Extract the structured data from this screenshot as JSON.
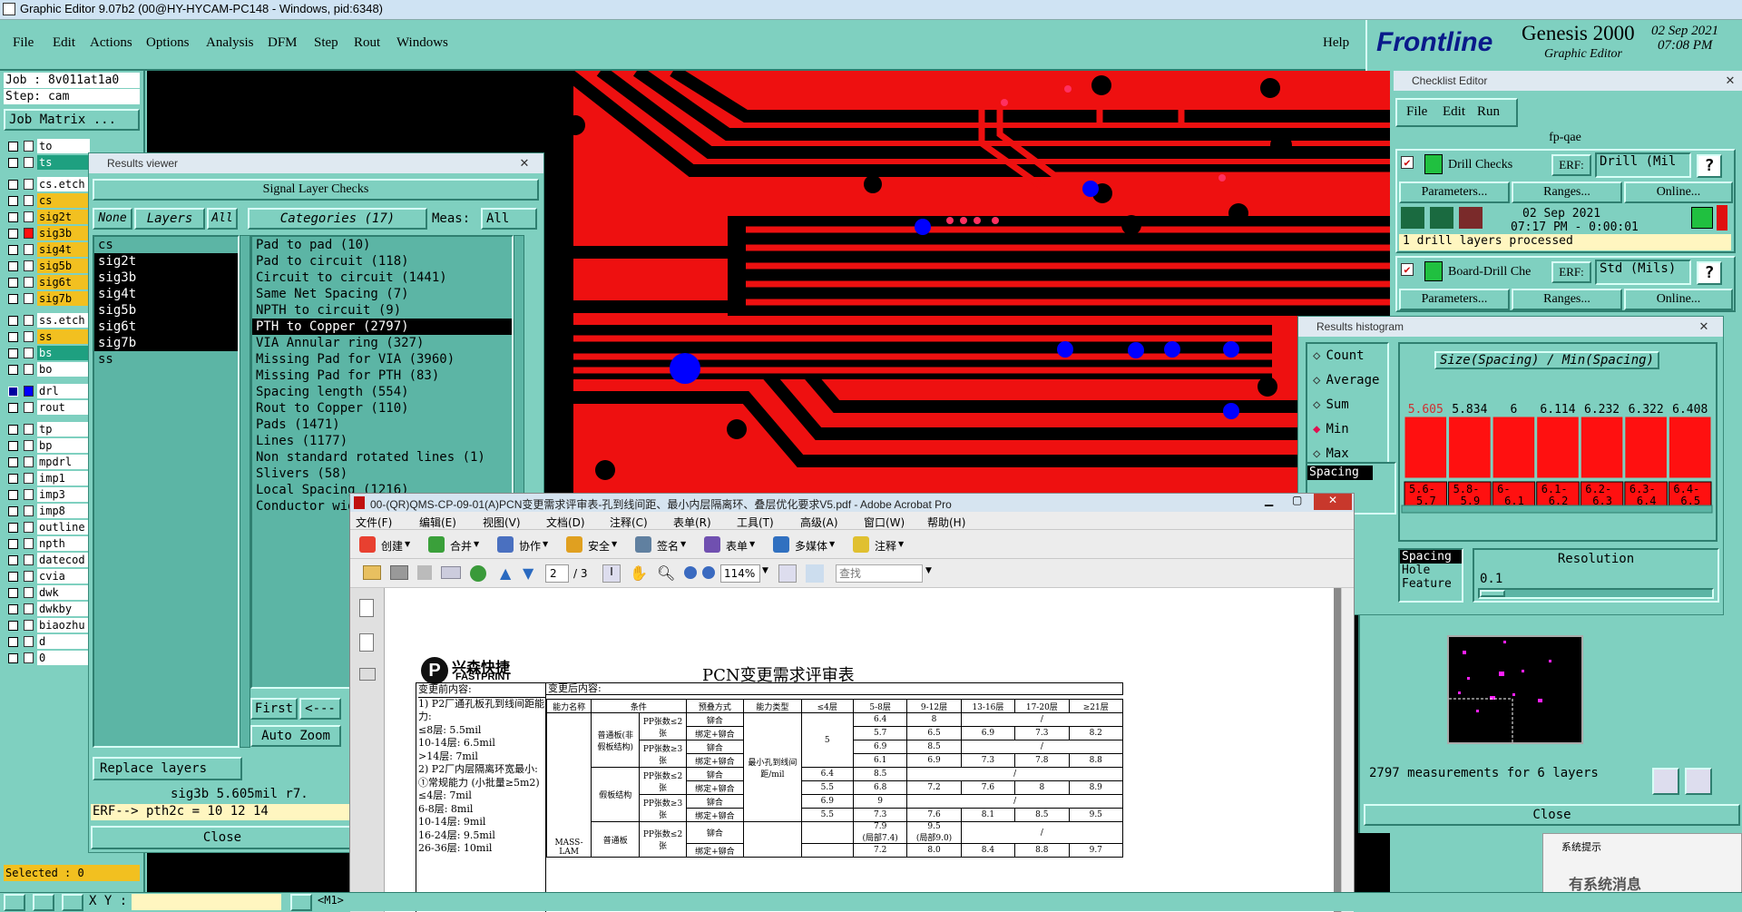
{
  "titlebar": {
    "title": "Graphic Editor 9.07b2 (00@HY-HYCAM-PC148 - Windows, pid:6348)"
  },
  "menu": {
    "items": [
      "File",
      "Edit",
      "Actions",
      "Options",
      "Analysis",
      "DFM",
      "Step",
      "Rout",
      "Windows"
    ],
    "help": "Help"
  },
  "brand": {
    "logo": "Frontline",
    "product": "Genesis 2000",
    "subtitle": "Graphic Editor",
    "date": "02 Sep 2021",
    "time": "07:08 PM"
  },
  "left": {
    "job": "Job : 8v011at1a0",
    "step": "Step: cam",
    "job_matrix": "Job Matrix ...",
    "layers": [
      {
        "name": "to",
        "style": "w",
        "checked": false
      },
      {
        "name": "ts",
        "style": "g",
        "checked": false
      },
      {
        "name": "cs.etch",
        "style": "w",
        "checked": false
      },
      {
        "name": "cs",
        "style": "y",
        "checked": false
      },
      {
        "name": "sig2t",
        "style": "y",
        "checked": false
      },
      {
        "name": "sig3b",
        "style": "y",
        "checked": false,
        "red": true
      },
      {
        "name": "sig4t",
        "style": "y",
        "checked": false
      },
      {
        "name": "sig5b",
        "style": "y",
        "checked": false
      },
      {
        "name": "sig6t",
        "style": "y",
        "checked": false
      },
      {
        "name": "sig7b",
        "style": "y",
        "checked": false
      },
      {
        "name": "ss.etch",
        "style": "w",
        "checked": false
      },
      {
        "name": "ss",
        "style": "y",
        "checked": false
      },
      {
        "name": "bs",
        "style": "g",
        "checked": false
      },
      {
        "name": "bo",
        "style": "w",
        "checked": false
      },
      {
        "name": "drl",
        "style": "w",
        "checked": true
      },
      {
        "name": "rout",
        "style": "w",
        "checked": false
      },
      {
        "name": "tp",
        "style": "w",
        "checked": false
      },
      {
        "name": "bp",
        "style": "w",
        "checked": false
      },
      {
        "name": "mpdrl",
        "style": "w",
        "checked": false
      },
      {
        "name": "imp1",
        "style": "w",
        "checked": false
      },
      {
        "name": "imp3",
        "style": "w",
        "checked": false
      },
      {
        "name": "imp8",
        "style": "w",
        "checked": false
      },
      {
        "name": "outline",
        "style": "w",
        "checked": false
      },
      {
        "name": "npth",
        "style": "w",
        "checked": false
      },
      {
        "name": "datecod",
        "style": "w",
        "checked": false
      },
      {
        "name": "cvia",
        "style": "w",
        "checked": false
      },
      {
        "name": "dwk",
        "style": "w",
        "checked": false
      },
      {
        "name": "dwkby",
        "style": "w",
        "checked": false
      },
      {
        "name": "biaozhu",
        "style": "w",
        "checked": false
      },
      {
        "name": "d",
        "style": "w",
        "checked": false
      },
      {
        "name": "0",
        "style": "w",
        "checked": false
      }
    ],
    "selected": "Selected : 0"
  },
  "results_viewer": {
    "title": "Results viewer",
    "heading": "Signal Layer Checks",
    "none": "None",
    "layers_label": "Layers",
    "all": "All",
    "categories": "Categories (17)",
    "meas_label": "Meas:",
    "meas_value": "All",
    "layer_list": [
      "cs",
      "sig2t",
      "sig3b",
      "sig4t",
      "sig5b",
      "sig6t",
      "sig7b",
      "ss"
    ],
    "category_list": [
      "Pad to pad (10)",
      "Pad to circuit (118)",
      "Circuit to circuit (1441)",
      "Same Net Spacing (7)",
      "NPTH to circuit (9)",
      "PTH to Copper (2797)",
      "VIA Annular ring (327)",
      "Missing Pad for VIA (3960)",
      "Missing Pad for PTH (83)",
      "Spacing length (554)",
      "Rout to Copper (110)",
      "Pads (1471)",
      "Lines (1177)",
      "Non standard rotated lines (1)",
      "Slivers (58)",
      "Local Spacing (1216)",
      "Conductor width (...)"
    ],
    "first": "First",
    "prev": "<---",
    "auto_zoom": "Auto Zoom",
    "replace_layers": "Replace layers",
    "status": "sig3b 5.605mil r7.",
    "erf": "ERF--> pth2c = 10 12 14",
    "close": "Close"
  },
  "checklist": {
    "title": "Checklist Editor",
    "menu": [
      "File",
      "Edit",
      "Run"
    ],
    "name": "fp-qae",
    "drill_checks": "Drill Checks",
    "erf_label": "ERF:",
    "erf1": "Drill (Mil",
    "parameters": "Parameters...",
    "ranges": "Ranges...",
    "online": "Online...",
    "date": "02 Sep 2021",
    "time": "07:17 PM - 0:00:01",
    "processed": "1 drill layers processed",
    "board_drill": "Board-Drill Che",
    "erf2": "Std (Mils)",
    "measurements": "2797 measurements for 6 layers",
    "close": "Close"
  },
  "histogram": {
    "title": "Results histogram",
    "options": [
      "Count",
      "Average",
      "Sum",
      "Min",
      "Max"
    ],
    "selected_option": "Min",
    "axis_title": "Size(Spacing) / Min(Spacing)",
    "spacing": "Spacing",
    "hole": "Hole",
    "feature": "Feature",
    "resolution_label": "Resolution",
    "resolution_value": "0.1"
  },
  "chart_data": {
    "type": "bar",
    "title": "Size(Spacing) / Min(Spacing)",
    "categories": [
      "5.6-5.7",
      "5.8-5.9",
      "6-6.1",
      "6.1-6.2",
      "6.2-6.3",
      "6.3-6.4",
      "6.4-6.5"
    ],
    "value_labels": [
      "5.605",
      "5.834",
      "6",
      "6.114",
      "6.232",
      "6.322",
      "6.408"
    ],
    "values": [
      5.605,
      5.834,
      6,
      6.114,
      6.232,
      6.322,
      6.408
    ],
    "bar_color": "#ff1010",
    "highlight_first": "#d03030"
  },
  "pdf": {
    "title": "00-(QR)QMS-CP-09-01(A)PCN变更需求评审表-孔到线间距、最小内层隔离环、叠层优化要求V5.pdf - Adobe Acrobat Pro",
    "menu": [
      "文件(F)",
      "编辑(E)",
      "视图(V)",
      "文档(D)",
      "注释(C)",
      "表单(R)",
      "工具(T)",
      "高级(A)",
      "窗口(W)",
      "帮助(H)"
    ],
    "toolbar": [
      "创建",
      "合并",
      "协作",
      "安全",
      "签名",
      "表单",
      "多媒体",
      "注释"
    ],
    "page": "2",
    "pages": "/ 3",
    "zoom": "114%",
    "find_placeholder": "查找",
    "doc": {
      "logo_cn": "兴森快捷",
      "logo_en": "FASTPRINT",
      "heading": "PCN变更需求评审表",
      "before_label": "变更前内容:",
      "after_label": "变更后内容:",
      "before_lines": [
        "1) P2厂通孔板孔到线间距能",
        "力:",
        "≤8层: 5.5mil",
        "10-14层: 6.5mil",
        ">14层: 7mil",
        "2) P2厂内层隔离环宽最小:",
        "①常规能力 (小批量≥5m2)",
        "≤4层: 7mil",
        "6-8层: 8mil",
        "10-14层: 9mil",
        "16-24层: 9.5mil",
        "26-36层: 10mil"
      ],
      "table_headers": [
        "能力名称",
        "条件",
        "预叠方式",
        "能力类型",
        "≤4层",
        "5-8层",
        "9-12层",
        "13-16层",
        "17-20层",
        "≥21层"
      ],
      "rows": [
        [
          "普通板(非假板结构)",
          "PP张数≤2张",
          "铆合",
          "",
          "8",
          "/"
        ],
        [
          "",
          "",
          "绑定+铆合",
          "5.7",
          "6.5",
          "6.9",
          "7.3",
          "8.2"
        ],
        [
          "",
          "PP张数≥3张",
          "铆合",
          "6.9",
          "8.5",
          "/"
        ],
        [
          "",
          "",
          "绑定+铆合",
          "6.1",
          "6.9",
          "7.3",
          "7.8",
          "8.8"
        ]
      ],
      "cells": {
        "r1": [
          "6.4",
          "8",
          "/"
        ],
        "r2": [
          "5.7",
          "6.5",
          "6.9",
          "7.3",
          "8.2"
        ],
        "r3": [
          "6.9",
          "8.5",
          "/"
        ],
        "r4": [
          "6.1",
          "6.9",
          "7.3",
          "7.8",
          "8.8"
        ],
        "r5": [
          "6.4",
          "8.5",
          "/"
        ],
        "r6": [
          "5.5",
          "6.8",
          "7.2",
          "7.6",
          "8",
          "8.9"
        ],
        "r7": [
          "6.9",
          "9",
          "/"
        ],
        "r8": [
          "5.5",
          "7.3",
          "7.6",
          "8.1",
          "8.5",
          "9.5"
        ],
        "r9": [
          "7.9",
          "9.5",
          "/"
        ],
        "r9b": [
          "(局部7.4)",
          "(局部9.0)"
        ],
        "r10": [
          "7.2",
          "8.0",
          "8.4",
          "8.8",
          "9.7"
        ]
      },
      "cond": {
        "normal": "普通板(非假板结构)",
        "fake": "假板结构",
        "pp2": "PP张数≤2张",
        "pp3": "PP张数≥3张",
        "rivet": "铆合",
        "bind": "绑定+铆合",
        "ability": "最小孔到线间距/mil",
        "five": "5",
        "mass": "MASS-LAM",
        "normal2": "普通板"
      }
    }
  },
  "bottom": {
    "xy": "X Y :",
    "m1": "<M1>"
  },
  "notify": {
    "title": "系统提示",
    "message": "有系统消息"
  }
}
